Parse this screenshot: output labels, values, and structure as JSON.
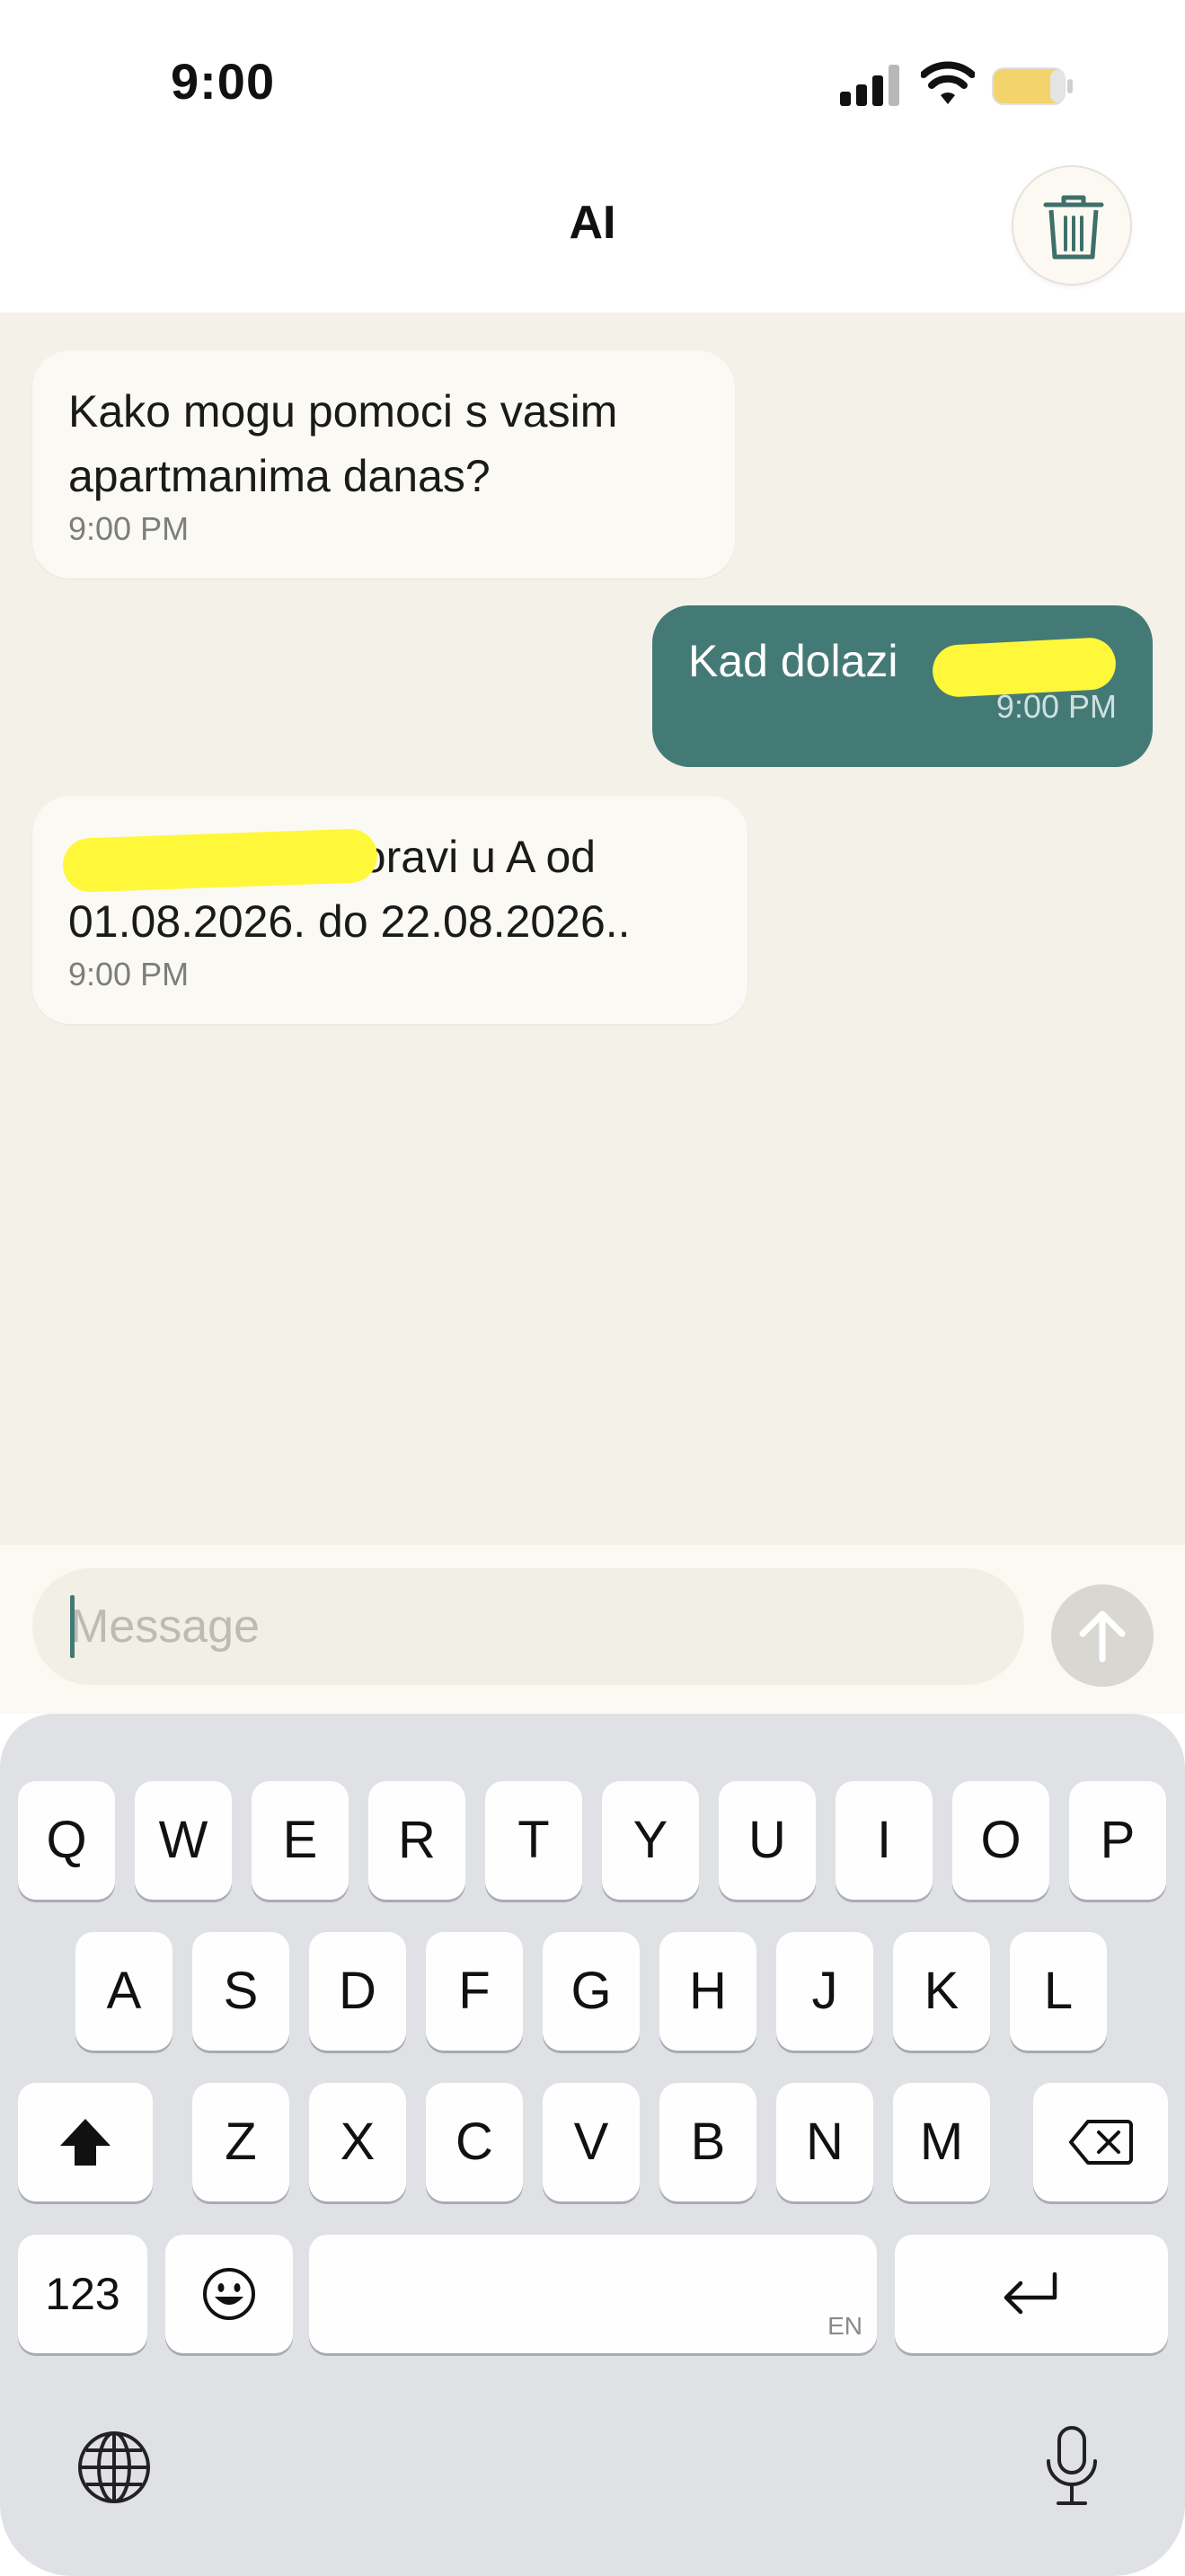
{
  "status_bar": {
    "time": "9:00"
  },
  "header": {
    "title": "AI"
  },
  "messages": [
    {
      "text": "Kako mogu pomoci s vasim apartmanima danas?",
      "time": "9:00 PM"
    },
    {
      "text": "Kad dolazi",
      "time": "9:00 PM"
    },
    {
      "text_line1": "boravi u A od",
      "text_line2": "01.08.2026. do 22.08.2026..",
      "time": "9:00 PM"
    }
  ],
  "composer": {
    "placeholder": "Message"
  },
  "keyboard": {
    "row1": [
      "Q",
      "W",
      "E",
      "R",
      "T",
      "Y",
      "U",
      "I",
      "O",
      "P"
    ],
    "row2": [
      "A",
      "S",
      "D",
      "F",
      "G",
      "H",
      "J",
      "K",
      "L"
    ],
    "row3": [
      "Z",
      "X",
      "C",
      "V",
      "B",
      "N",
      "M"
    ],
    "numbers_label": "123",
    "space_language": "EN"
  },
  "colors": {
    "accent": "#447a76",
    "chat_background": "#f4f1e8",
    "redaction": "#fff73a"
  }
}
